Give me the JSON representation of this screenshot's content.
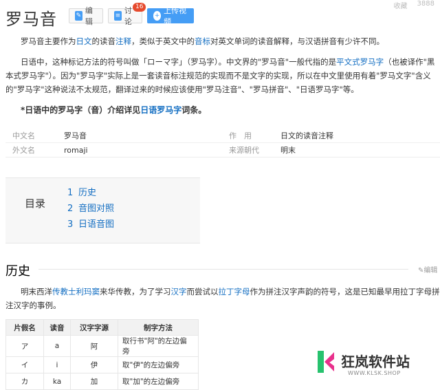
{
  "top_tools": [
    "收藏",
    "3888"
  ],
  "page_title": "罗马音",
  "buttons": {
    "edit": "编辑",
    "discuss": "讨论",
    "discuss_count": "16",
    "upload_video": "上传视频"
  },
  "intro": {
    "p1": {
      "t1": "罗马音主要作为",
      "l1": "日文",
      "t2": "的读音",
      "l2": "注释",
      "t3": "，类似于英文中的",
      "l3": "音标",
      "t4": "对英文单词的读音解释，与汉语拼音有少许不同。"
    },
    "p2": {
      "t1": "日语中，这种标记方法的符号叫做「ローマ字」（罗马字）。中文界的\"罗马音\"一般代指的是",
      "l1": "平文式罗马字",
      "t2": "（也被译作\"黑本式罗马字\"）。因为\"罗马字\"实际上是一套读音标注规范的实现而不是文字的实现，所以在中文里使用有着\"罗马文字\"含义的\"罗马字\"这种说法不太规范，翻译过来的时候应该使用\"罗马注音\"、\"罗马拼音\"、\"日语罗马字\"等。"
    }
  },
  "note": {
    "t1": "*日语中的罗马字（音）介绍详见",
    "l1": "日语罗马字",
    "t2": "词条。"
  },
  "infobox": [
    {
      "k1": "中文名",
      "v1": "罗马音",
      "k2": "作　用",
      "v2": "日文的读音注释"
    },
    {
      "k1": "外文名",
      "v1": "romaji",
      "k2": "来源朝代",
      "v2": "明末"
    }
  ],
  "toc": {
    "label": "目录",
    "items": [
      {
        "num": "1",
        "text": "历史"
      },
      {
        "num": "2",
        "text": "音图对照"
      },
      {
        "num": "3",
        "text": "日语音图"
      }
    ]
  },
  "history": {
    "heading": "历史",
    "edit": "编辑",
    "p": {
      "t1": "明末西洋",
      "l1": "传教士",
      "l2": "利玛窦",
      "t2": "来华传教，为了学习",
      "l3": "汉字",
      "t3": "而尝试以",
      "l4": "拉丁字母",
      "t4": "作为拼注汉字声韵的符号，这是已知最早用拉丁字母拼注汉字的事例。"
    }
  },
  "kana_table": {
    "headers": [
      "片假名",
      "读音",
      "汉字字源",
      "制字方法"
    ],
    "rows": [
      [
        "ア",
        "a",
        "阿",
        "取行书\"阿\"的左边偏旁"
      ],
      [
        "イ",
        "i",
        "伊",
        "取\"伊\"的左边偏旁"
      ],
      [
        "カ",
        "ka",
        "加",
        "取\"加\"的左边偏旁"
      ]
    ]
  },
  "watermark": {
    "name": "狂岚软件站",
    "url": "WWW.KLSK.SHOP"
  },
  "colors": {
    "link": "#136ec2",
    "primary": "#459df5",
    "badge": "#e64a2e",
    "watermark_green": "#27c26e",
    "watermark_pink": "#e8308c"
  }
}
